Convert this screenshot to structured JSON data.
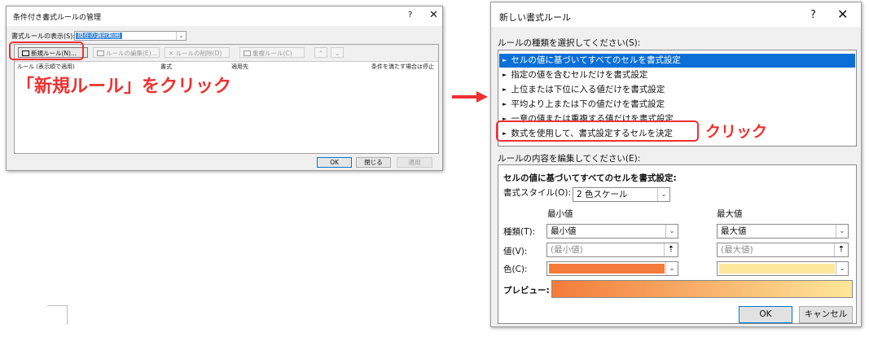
{
  "dialog1": {
    "title": "条件付き書式ルールの管理",
    "help": "?",
    "close": "✕",
    "show_rules_label": "書式ルールの表示(S):",
    "show_rules_value": "現在の選択範囲",
    "toolbar": {
      "new_rule": "新規ルール(N)...",
      "edit_rule": "ルールの編集(E)...",
      "delete_rule": "ルールの削除(D)",
      "duplicate_rule": "重複ルール(C)",
      "move_up": "⌃",
      "move_down": "⌄"
    },
    "columns": [
      "ルール (表示順で適用)",
      "書式",
      "適用先",
      "条件を満たす場合は停止"
    ],
    "buttons": {
      "ok": "OK",
      "close": "閉じる",
      "apply": "適用"
    }
  },
  "annotation1": "「新規ルール」をクリック",
  "annotation2": "クリック",
  "dialog2": {
    "title": "新しい書式ルール",
    "help": "?",
    "close": "✕",
    "select_type_label": "ルールの種類を選択してください(S):",
    "rule_types": [
      "セルの値に基づいてすべてのセルを書式設定",
      "指定の値を含むセルだけを書式設定",
      "上位または下位に入る値だけを書式設定",
      "平均より上または下の値だけを書式設定",
      "一意の値または重複する値だけを書式設定",
      "数式を使用して、書式設定するセルを決定"
    ],
    "selected_index": 0,
    "edit_label": "ルールの内容を編集してください(E):",
    "edit_heading": "セルの値に基づいてすべてのセルを書式設定:",
    "format_style_label": "書式スタイル(O):",
    "format_style_value": "2 色スケール",
    "min_header": "最小値",
    "max_header": "最大値",
    "type_label": "種類(T):",
    "min_type": "最小値",
    "max_type": "最大値",
    "value_label": "値(V):",
    "min_value_placeholder": "(最小値)",
    "max_value_placeholder": "(最大値)",
    "color_label": "色(C):",
    "preview_label": "プレビュー:",
    "buttons": {
      "ok": "OK",
      "cancel": "キャンセル"
    }
  },
  "colors": {
    "accent_red": "#ef3030",
    "selection_blue": "#0a6fd6",
    "min_color": "#f47b3a",
    "max_color": "#fde79a"
  }
}
